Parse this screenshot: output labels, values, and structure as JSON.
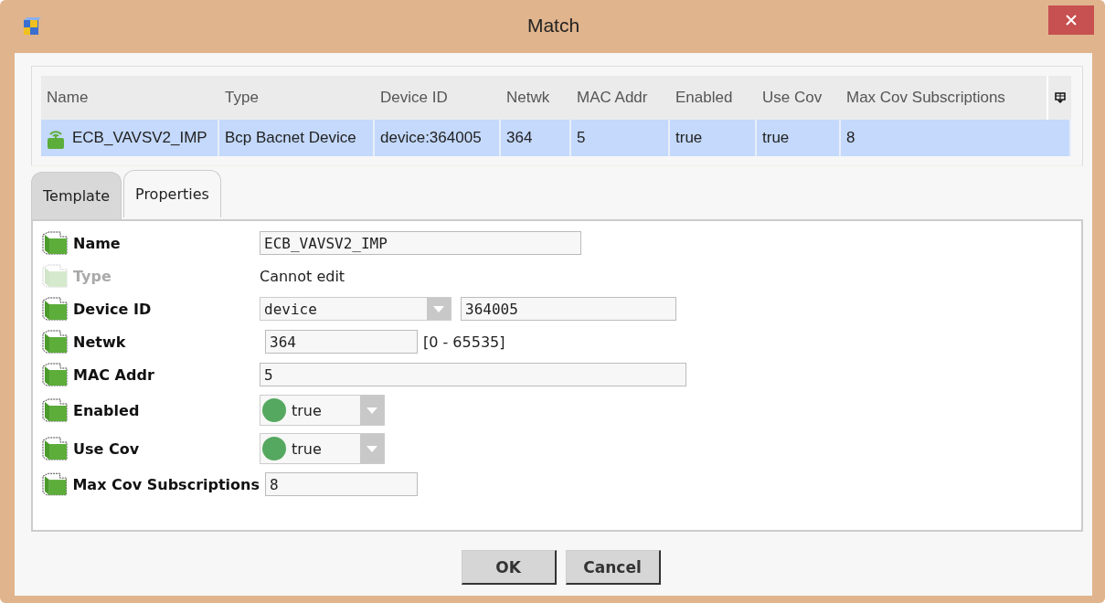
{
  "window": {
    "title": "Match"
  },
  "table": {
    "columns": [
      "Name",
      "Type",
      "Device ID",
      "Netwk",
      "MAC Addr",
      "Enabled",
      "Use Cov",
      "Max Cov Subscriptions"
    ],
    "rows": [
      {
        "selected": true,
        "cells": [
          "ECB_VAVSV2_IMP",
          "Bcp Bacnet Device",
          "device:364005",
          "364",
          "5",
          "true",
          "true",
          "8"
        ]
      }
    ]
  },
  "tabs": [
    {
      "label": "Template",
      "selected": false
    },
    {
      "label": "Properties",
      "selected": true
    }
  ],
  "properties": [
    {
      "kind": "string",
      "label": "Name",
      "disabled": false,
      "value": "ECB_VAVSV2_IMP"
    },
    {
      "kind": "readonly",
      "label": "Type",
      "disabled": true,
      "value": "Cannot edit"
    },
    {
      "kind": "ordinal",
      "label": "Device ID",
      "disabled": false,
      "option": "device",
      "value": "364005"
    },
    {
      "kind": "integer",
      "label": "Netwk",
      "disabled": false,
      "value": "364",
      "range": "[0 - 65535]"
    },
    {
      "kind": "address",
      "label": "MAC Addr",
      "disabled": false,
      "value": "5"
    },
    {
      "kind": "boolean",
      "label": "Enabled",
      "disabled": false,
      "value": "true"
    },
    {
      "kind": "boolean",
      "label": "Use Cov",
      "disabled": false,
      "value": "true"
    },
    {
      "kind": "integer",
      "label": "Max Cov Subscriptions",
      "disabled": false,
      "value": "8"
    }
  ],
  "buttons": [
    "OK",
    "Cancel"
  ]
}
